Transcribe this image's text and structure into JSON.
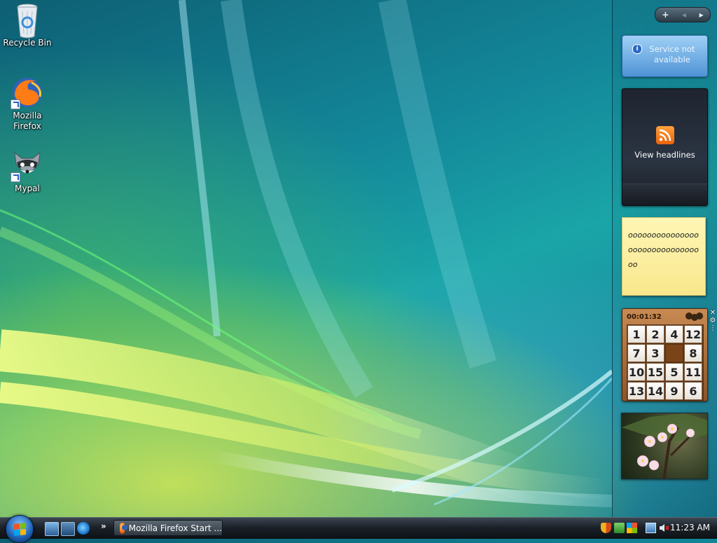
{
  "desktop": {
    "icons": [
      {
        "label": "Recycle Bin",
        "icon": "recycle-bin-icon"
      },
      {
        "label": "Mozilla Firefox",
        "icon": "firefox-icon"
      },
      {
        "label": "Mypal",
        "icon": "mypal-raccoon-icon"
      }
    ]
  },
  "sidebar": {
    "controls": {
      "add": "+",
      "prev": "◂",
      "next": "▸"
    },
    "service_gadget": {
      "text": "Service not available"
    },
    "feed_gadget": {
      "label": "View headlines"
    },
    "notes_gadget": {
      "text": "oooooooooooooooooooooooooooooooo"
    },
    "puzzle_gadget": {
      "timer": "00:01:32",
      "tiles": [
        [
          "1",
          "2",
          "4",
          "12"
        ],
        [
          "7",
          "3",
          "",
          "8"
        ],
        [
          "10",
          "15",
          "5",
          "11"
        ],
        [
          "13",
          "14",
          "9",
          "6"
        ]
      ]
    },
    "close_glyph": "✕"
  },
  "taskbar": {
    "quicklaunch_chevron": "»",
    "tasks": [
      {
        "label": "Mozilla Firefox Start ...",
        "icon": "firefox-icon"
      }
    ],
    "clock": "11:23 AM"
  },
  "colors": {
    "accent": "#1c8ca0",
    "taskbar": "#1b2128",
    "note": "#fff6b6",
    "puzzle_wood": "#a86a3a"
  }
}
